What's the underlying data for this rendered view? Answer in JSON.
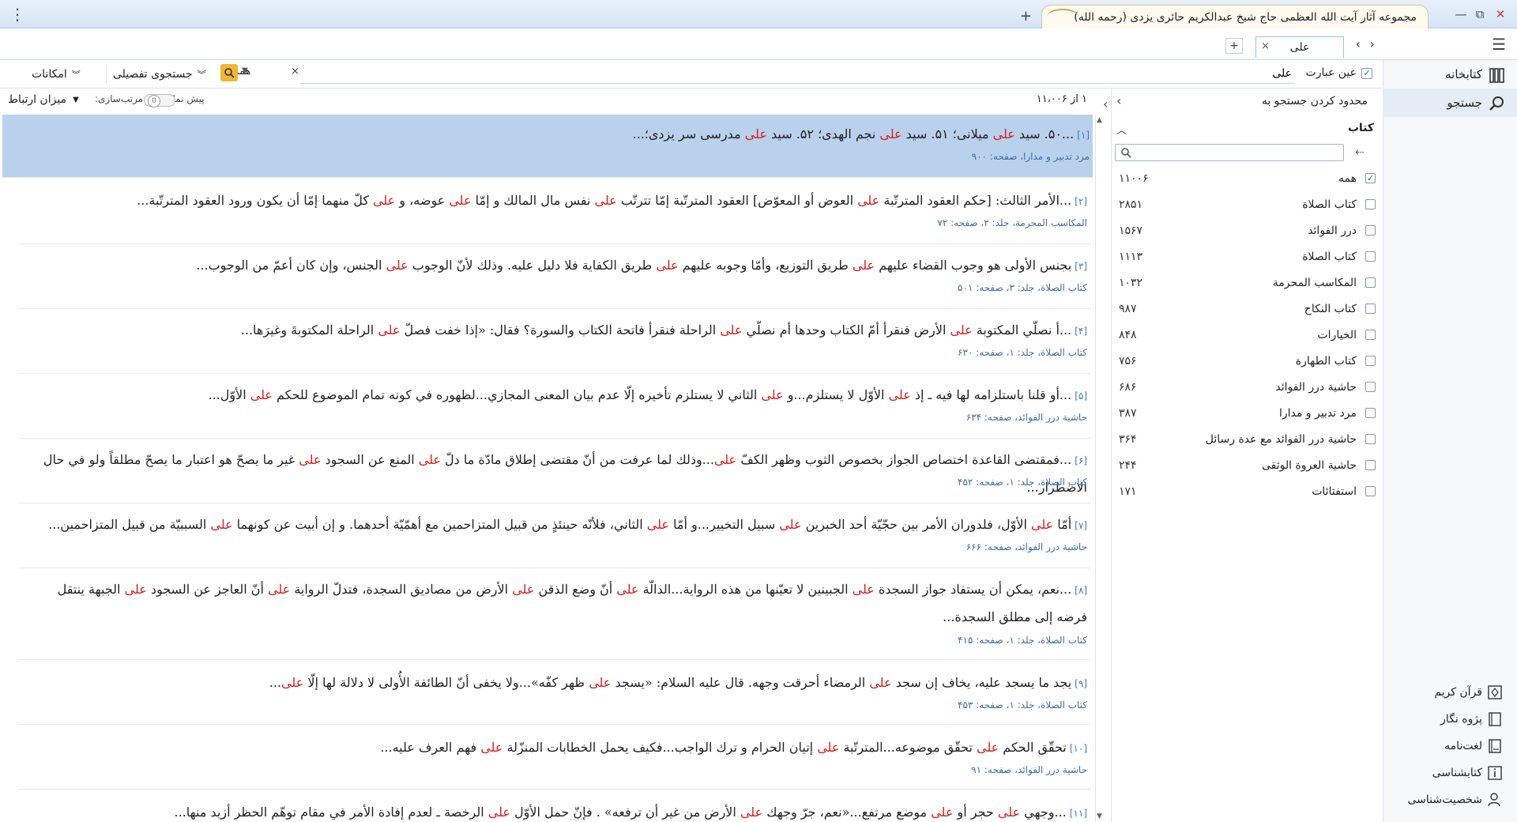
{
  "window": {
    "title": "مجموعه آثار آیت الله العظمی حاج شیخ عبدالکریم حائری یزدی (رحمه الله)",
    "minimize": "—",
    "restore": "⧉",
    "close": "✕"
  },
  "tabs": {
    "doc_tab": "علی"
  },
  "nav": {
    "library": "کتابخانه",
    "search": "جستجو",
    "bottom": [
      "قرآن کریم",
      "پژوه نگار",
      "لغت‌نامه",
      "کتابشناسی",
      "شخصیت‌شناسی"
    ]
  },
  "search": {
    "exact_label": "عین عبارت",
    "query": "علی",
    "scope": "همه",
    "advanced": "جستجوی تفصیلی",
    "options": "امکانات"
  },
  "results_head": {
    "count": "۱ از ۱۱،۰۰۶",
    "preview": "پیش نمایش",
    "sort": "مرتب‌سازی:",
    "relevance": "میزان ارتباط"
  },
  "filter": {
    "title": "محدود کردن جستجو به",
    "books_head": "کتاب",
    "books": [
      {
        "name": "همه",
        "count": "۱۱۰۰۶",
        "checked": true
      },
      {
        "name": "کتاب الصلاة",
        "count": "۲۸۵۱",
        "checked": false
      },
      {
        "name": "درر الفوائد",
        "count": "۱۵۶۷",
        "checked": false
      },
      {
        "name": "کتاب الصلاة",
        "count": "۱۱۱۳",
        "checked": false
      },
      {
        "name": "المکاسب المحرمة",
        "count": "۱۰۳۲",
        "checked": false
      },
      {
        "name": "کتاب النکاح",
        "count": "۹۸۷",
        "checked": false
      },
      {
        "name": "الخیارات",
        "count": "۸۴۸",
        "checked": false
      },
      {
        "name": "کتاب الطهارة",
        "count": "۷۵۶",
        "checked": false
      },
      {
        "name": "حاشیة درر الفوائد",
        "count": "۶۸۶",
        "checked": false
      },
      {
        "name": "مرد تدبیر و مدارا",
        "count": "۳۸۷",
        "checked": false
      },
      {
        "name": "حاشیة درر الفوائد مع عدة رسائل",
        "count": "۳۶۴",
        "checked": false
      },
      {
        "name": "حاشیة العروة الوثقی",
        "count": "۲۴۴",
        "checked": false
      },
      {
        "name": "استفتائات",
        "count": "۱۷۱",
        "checked": false
      }
    ]
  },
  "results": [
    {
      "num": "[۱]",
      "src": "مرد تدبیر و مدارا، صفحه: ۹۰۰",
      "parts": [
        "...۵۰. سید ",
        "علی",
        " میلانی؛ ۵۱. سید ",
        "علی",
        " نجم الهدی؛ ۵۲. سید ",
        "علی",
        " مدرسی سر یزدی؛..."
      ]
    },
    {
      "num": "[۲]",
      "src": "المکاسب المحرمة، جلد: ۲، صفحه: ۷۲",
      "parts": [
        "...الأمر الثالث: [حكم العقود المترتّبة ",
        "علی",
        " العوض أو المعوّض] العقود المترتّبة إمّا تترتّب ",
        "علی",
        " نفس مال المالك و إمّا ",
        "علی",
        " عوضه، و ",
        "علی",
        " كلّ منهما إمّا أن يكون ورود العقود المترتّبة..."
      ]
    },
    {
      "num": "[۳]",
      "src": "کتاب الصلاة، جلد: ۳، صفحه: ۵۰۱",
      "parts": [
        "بجنس الأولی هو وجوب القضاء عليهم ",
        "علی",
        " طريق التوزيع، وأمّا وجوبه عليهم ",
        "علی",
        " طريق الكفاية فلا دليل عليه. وذلك لأنّ الوجوب ",
        "علی",
        " الجنس، وإن كان أعمّ من الوجوب..."
      ]
    },
    {
      "num": "[۴]",
      "src": "کتاب الصلاة، جلد: ۱، صفحه: ۶۳۰",
      "parts": [
        "...أ نصلّي المكتوبة ",
        "علی",
        " الأرض فنقرأ أمّ الكتاب وحدها أم نصلّي ",
        "علی",
        " الراحلة فنقرأ فاتحة الكتاب والسورة؟ فقال: «إذا خفت فصلّ ",
        "علی",
        " الراحلة المكتوبةَ وغيرَها..."
      ]
    },
    {
      "num": "[۵]",
      "src": "حاشیة درر الفوائد، صفحه: ۶۳۴",
      "parts": [
        "...أو قلنا باستلزامه لها فيه ـ إذ ",
        "علی",
        " الأوّل لا يستلزم...و ",
        "علی",
        " الثاني لا يستلزم تأخيره إلّا عدم بيان المعنى المجازي...لظهوره في كونه تمام الموضوع للحكم ",
        "علی",
        " الأوّل..."
      ]
    },
    {
      "num": "[۶]",
      "src": "کتاب الصلاة، جلد: ۱، صفحه: ۴۵۲",
      "parts": [
        "...فمقتضى القاعدة اختصاص الجواز بخصوص الثوب وظهر الكفّ ",
        "علی",
        "...وذلك لما عرفت من أنّ مقتضى إطلاق مادّة ما دلّ ",
        "علی",
        " المنع عن السجود ",
        "علی",
        " غير ما يصحّ هو اعتبار ما يصحّ مطلقاً ولو في حال الاضطرار..."
      ]
    },
    {
      "num": "[۷]",
      "src": "حاشیة درر الفوائد، صفحه: ۶۶۶",
      "parts": [
        "أمّا ",
        "علی",
        " الأوّل، فلدوران الأمر بين حجّيّة أحد الخبرين ",
        "علی",
        " سبيل التخيير...و أمّا ",
        "علی",
        " الثاني، فلأنّه حينئذٍ من قبيل المتزاحمين مع أهمّيّة أحدهما. و إن أبيت عن كونهما ",
        "علی",
        " السببيّة من قبيل المتزاحمين..."
      ]
    },
    {
      "num": "[۸]",
      "src": "کتاب الصلاة، جلد: ۱، صفحه: ۴۱۵",
      "parts": [
        "...نعم، يمكن أن يستفاد جواز السجدة ",
        "علی",
        " الجبينين لا تعيّنها من هذه الرواية...الدالّة ",
        "علی",
        " أنّ وضع الذقن ",
        "علی",
        " الأرض من مصاديق السجدة، فتدلّ الرواية ",
        "علی",
        " أنّ العاجز عن السجود ",
        "علی",
        " الجبهة ينتقل فرضه إلى مطلق السجدة..."
      ]
    },
    {
      "num": "[۹]",
      "src": "کتاب الصلاة، جلد: ۱، صفحه: ۴۵۳",
      "parts": [
        "يجد ما يسجد عليه، يخاف إن سجد ",
        "علی",
        " الرمضاء أحرقت وجهه. قال عليه السلام: «يسجد ",
        "علی",
        " ظهر كفّه»...ولا يخفى أنّ الطائفة الأُولى لا دلالة لها إلّا ",
        "علی",
        "..."
      ]
    },
    {
      "num": "[۱۰]",
      "src": "حاشیة درر الفوائد، صفحه: ۹۱",
      "parts": [
        "تحقّق الحكم ",
        "علی",
        " تحقّق موضوعه...المترتّبة ",
        "علی",
        " إتيان الحرام و ترك الواجب...فكيف يحمل الخطابات المنزّلة ",
        "علی",
        " فهم العرف عليه..."
      ]
    },
    {
      "num": "[۱۱]",
      "src": "",
      "parts": [
        "...وجهي ",
        "علی",
        " حجر أو ",
        "علی",
        " موضع مرتفع...«نعم، جرّ وجهك ",
        "علی",
        " الأرض من غير أن ترفعه» . فإنّ حمل الأوّل ",
        "علی",
        " الرخصة ـ لعدم إفادة الأمر في مقام توهّم الحظر أزيد منها..."
      ]
    }
  ],
  "colors": {
    "highlight": "#d8201e",
    "selected": "#b9d1ec",
    "accent": "#f2b632",
    "source": "#3e6ea8"
  }
}
